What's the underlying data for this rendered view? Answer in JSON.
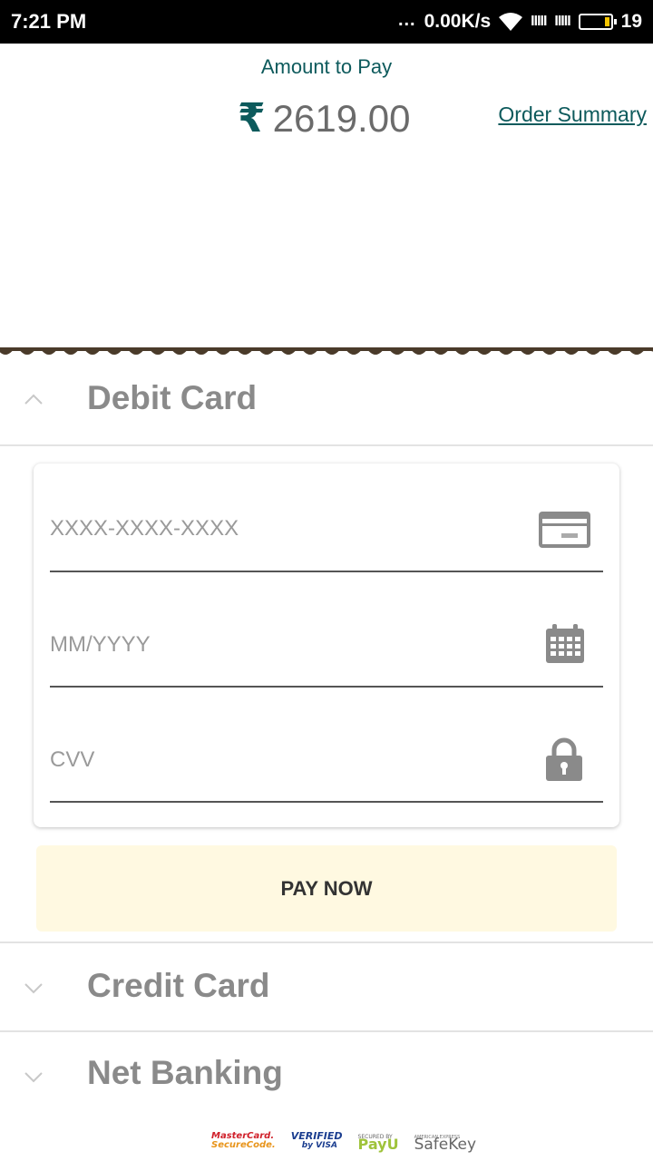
{
  "status_bar": {
    "time": "7:21 PM",
    "dots": "...",
    "network_speed": "0.00K/s",
    "signal1": "IIIII",
    "signal2": "IIIII",
    "battery": "19"
  },
  "header": {
    "amount_label": "Amount to Pay",
    "currency_symbol": "₹",
    "amount": "2619.00",
    "order_summary_link": "Order Summary"
  },
  "sections": {
    "debit": {
      "title": "Debit Card",
      "expanded": true
    },
    "credit": {
      "title": "Credit Card",
      "expanded": false
    },
    "netbanking": {
      "title": "Net Banking",
      "expanded": false
    }
  },
  "form": {
    "card_number_placeholder": "XXXX-XXXX-XXXX",
    "expiry_placeholder": "MM/YYYY",
    "cvv_placeholder": "CVV",
    "pay_button": "PAY NOW"
  },
  "badges": {
    "mastercard_top": "MasterCard.",
    "mastercard_bottom": "SecureCode.",
    "visa_top": "VERIFIED",
    "visa_bottom": "by VISA",
    "payu_top": "SECURED BY",
    "payu_bottom": "PayU",
    "safekey_top": "AMERICAN EXPRESS",
    "safekey_bottom": "SafeKey"
  },
  "colors": {
    "accent": "#0d5a5c",
    "pay_button_bg": "#fff9e1",
    "wave_border": "#4a3b2a"
  }
}
